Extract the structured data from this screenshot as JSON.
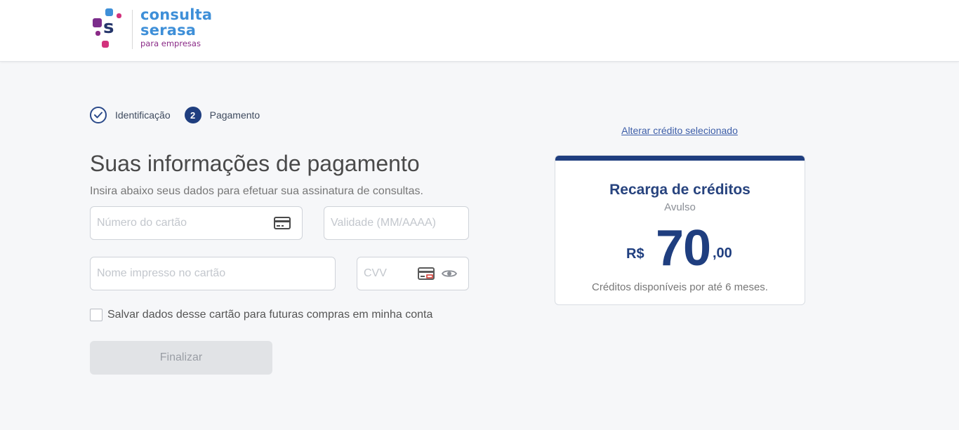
{
  "logo": {
    "line1": "consulta",
    "line2": "serasa",
    "line3": "para empresas",
    "colors": {
      "blue": "#3e8fd8",
      "purple": "#7b2d8b",
      "pink": "#d2327d",
      "navy": "#25366b"
    }
  },
  "steps": [
    {
      "label": "Identificação",
      "state": "done",
      "icon": "check-icon"
    },
    {
      "label": "Pagamento",
      "state": "active",
      "number": "2"
    }
  ],
  "page": {
    "title": "Suas informações de pagamento",
    "subtitle": "Insira abaixo seus dados para efetuar sua assinatura de consultas."
  },
  "form": {
    "card_number": {
      "placeholder": "Número do cartão",
      "value": "",
      "icon": "credit-card-icon"
    },
    "expiry": {
      "placeholder": "Validade (MM/AAAA)",
      "value": ""
    },
    "cardholder": {
      "placeholder": "Nome impresso no cartão",
      "value": ""
    },
    "cvv": {
      "placeholder": "CVV",
      "value": "",
      "icons": [
        "card-cvv-icon",
        "eye-icon"
      ]
    },
    "save_card_label": "Salvar dados desse cartão para futuras compras em minha conta",
    "save_card_checked": false,
    "submit_label": "Finalizar"
  },
  "summary": {
    "change_link": "Alterar crédito selecionado",
    "title": "Recarga de créditos",
    "subtitle": "Avulso",
    "currency": "R$",
    "price_integer": "70",
    "price_cents": ",00",
    "note": "Créditos disponíveis por até 6 meses.",
    "accent": "#1f3e7f"
  }
}
